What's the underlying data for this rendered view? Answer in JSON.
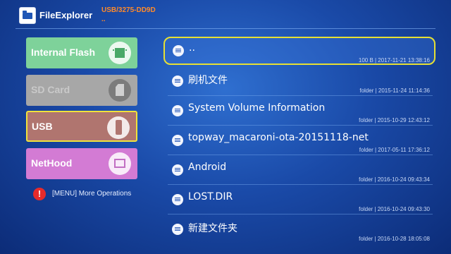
{
  "header": {
    "app_title": "FileExplorer",
    "path": "USB/3275-DD9D",
    "path_sub": ".."
  },
  "sidebar": {
    "items": [
      {
        "label": "Internal Flash",
        "icon": "internal-flash-icon",
        "color": "#7ed29a",
        "enabled": true
      },
      {
        "label": "SD Card",
        "icon": "sd-card-icon",
        "color": "#a7a7a7",
        "enabled": false
      },
      {
        "label": "USB",
        "icon": "usb-icon",
        "color": "#b0756f",
        "enabled": true,
        "selected": true
      },
      {
        "label": "NetHood",
        "icon": "network-icon",
        "color": "#d37bd4",
        "enabled": true
      }
    ],
    "menu_hint": "[MENU] More Operations",
    "menu_hint_icon": "exclamation-icon"
  },
  "files": [
    {
      "name": "..",
      "meta": "100 B | 2017-11-21 13:38:16",
      "selected": true
    },
    {
      "name": "刷机文件",
      "meta": "folder | 2015-11-24 11:14:36"
    },
    {
      "name": "System Volume Information",
      "meta": "folder | 2015-10-29 12:43:12"
    },
    {
      "name": "topway_macaroni-ota-20151118-net",
      "meta": "folder | 2017-05-11 17:36:12"
    },
    {
      "name": "Android",
      "meta": "folder | 2016-10-24 09:43:34"
    },
    {
      "name": "LOST.DIR",
      "meta": "folder | 2016-10-24 09:43:30"
    },
    {
      "name": "新建文件夹",
      "meta": "folder | 2016-10-28 18:05:08"
    }
  ],
  "colors": {
    "accent_path": "#ff8a2a",
    "selection_border": "#e6e034",
    "background": "#1a4aa8"
  }
}
